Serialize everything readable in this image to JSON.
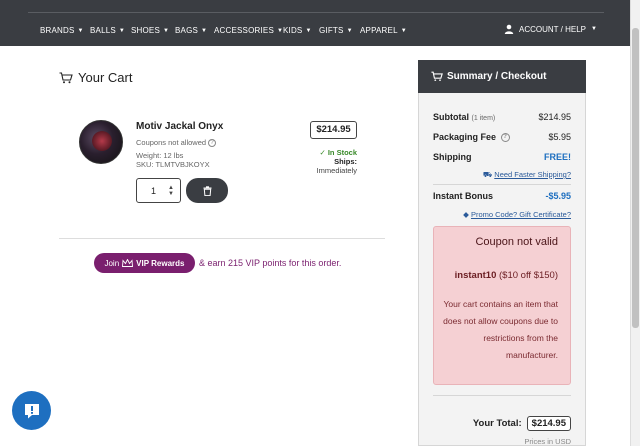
{
  "nav": {
    "items": [
      "BRANDS",
      "BALLS",
      "SHOES",
      "BAGS",
      "ACCESSORIES",
      "KIDS",
      "GIFTS",
      "APPAREL"
    ],
    "account": "ACCOUNT / HELP"
  },
  "cart": {
    "title": "Your Cart",
    "item": {
      "name": "Motiv Jackal Onyx",
      "coupons": "Coupons not allowed",
      "weight": "Weight: 12 lbs",
      "sku": "SKU: TLMTVBJKOYX",
      "price": "$214.95",
      "stock": "✓ In Stock",
      "ships": "Ships:",
      "ships_when": "Immediately",
      "quantity": "1"
    },
    "vip": {
      "join": "Join",
      "label": "VIP Rewards",
      "text": "& earn 215 VIP points for this order."
    }
  },
  "summary": {
    "title": "Summary / Checkout",
    "subtotal_label": "Subtotal",
    "subtotal_items": "(1 item)",
    "subtotal": "$214.95",
    "packaging_label": "Packaging Fee",
    "packaging": "$5.95",
    "shipping_label": "Shipping",
    "shipping": "FREE!",
    "faster_link": "Need Faster Shipping?",
    "bonus_label": "Instant Bonus",
    "bonus": "-$5.95",
    "promo_link": "Promo Code? Gift Certificate?",
    "coupon": {
      "title": "Coupon not valid",
      "code": "instant10",
      "code_detail": "($10 off $150)",
      "message": "Your cart contains an item that does not allow coupons due to restrictions from the manufacturer."
    },
    "total_label": "Your Total:",
    "total": "$214.95",
    "currency": "Prices in USD"
  },
  "colors": {
    "nav_bg": "#3a3d42",
    "vip": "#7a1f6e",
    "accent": "#1e6fc0",
    "coupon_bg": "#f5d0d3"
  }
}
